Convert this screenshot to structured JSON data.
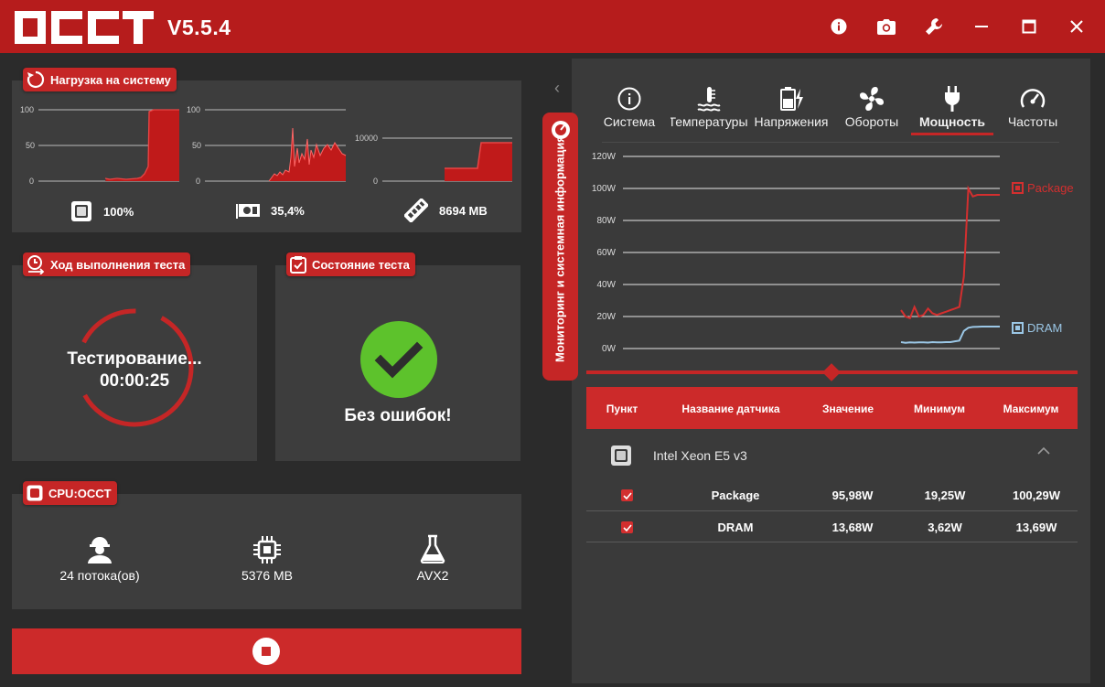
{
  "app": {
    "version": "V5.5.4"
  },
  "load_panel": {
    "title": "Нагрузка на систему",
    "charts": [
      {
        "ticks": [
          "100",
          "50",
          "0"
        ],
        "value": "100%",
        "icon": "cpu-icon"
      },
      {
        "ticks": [
          "100",
          "50",
          "0"
        ],
        "value": "35,4%",
        "icon": "gpu-icon"
      },
      {
        "ticks": [
          "10000",
          "0"
        ],
        "value": "8694 MB",
        "icon": "ram-icon"
      }
    ]
  },
  "progress_panel": {
    "title": "Ход выполнения теста",
    "status": "Тестирование...",
    "time": "00:00:25"
  },
  "state_panel": {
    "title": "Состояние теста",
    "status": "Без ошибок!"
  },
  "cpu_panel": {
    "title": "CPU:OCCT",
    "threads": "24 потока(ов)",
    "memory": "5376 MB",
    "instr": "AVX2"
  },
  "side_tab": {
    "label": "Мониторинг и системная информация"
  },
  "tabs": [
    {
      "label": "Система",
      "icon": "info-icon"
    },
    {
      "label": "Температуры",
      "icon": "thermometer-icon"
    },
    {
      "label": "Напряжения",
      "icon": "battery-bolt-icon"
    },
    {
      "label": "Обороты",
      "icon": "fan-icon"
    },
    {
      "label": "Мощность",
      "icon": "plug-icon",
      "active": true
    },
    {
      "label": "Частоты",
      "icon": "speedometer-icon"
    }
  ],
  "chart_data": {
    "type": "line",
    "title": "",
    "yticks": [
      "120W",
      "100W",
      "80W",
      "60W",
      "40W",
      "20W",
      "0W"
    ],
    "ylim": [
      0,
      120
    ],
    "grid": true,
    "legend": "right",
    "series": [
      {
        "name": "Package",
        "color": "#d32f2f",
        "values": [
          24,
          20,
          19,
          26,
          20,
          21,
          25,
          22,
          21,
          22,
          23,
          24,
          25,
          26,
          45,
          100,
          95,
          96,
          96,
          96,
          96,
          96,
          96
        ]
      },
      {
        "name": "DRAM",
        "color": "#9bc7e6",
        "values": [
          4,
          3.6,
          3.8,
          3.7,
          3.9,
          3.8,
          3.7,
          4,
          3.9,
          3.8,
          4,
          4,
          4.5,
          5,
          11,
          13,
          13.5,
          13.6,
          13.7,
          13.7,
          13.7,
          13.7,
          13.7
        ]
      }
    ]
  },
  "table": {
    "headers": [
      "Пункт",
      "Название датчика",
      "Значение",
      "Минимум",
      "Максимум"
    ],
    "group": "Intel Xeon E5 v3",
    "rows": [
      {
        "name": "Package",
        "value": "95,98W",
        "min": "19,25W",
        "max": "100,29W"
      },
      {
        "name": "DRAM",
        "value": "13,68W",
        "min": "3,62W",
        "max": "13,69W"
      }
    ]
  },
  "colors": {
    "accent": "#c52626",
    "ok": "#5dc22c",
    "panel": "#3d3d3d"
  }
}
